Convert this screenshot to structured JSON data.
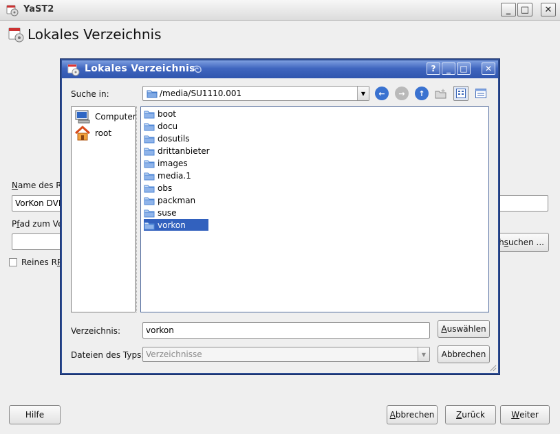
{
  "main_window": {
    "title": "YaST2",
    "heading": "Lokales Verzeichnis",
    "controls": {
      "minimize": "_",
      "maximize": "□",
      "close": "✕"
    },
    "name_label": "Name des Re",
    "name_label_mnemonic": "N",
    "name_label_rest": "ame des Re",
    "name_value": "VorKon DVD",
    "path_label_pre": "P",
    "path_label_mnemonic": "f",
    "path_label_rest": "ad zum Ver",
    "path_value": "",
    "browse_pre": "rch",
    "browse_mnemonic": "s",
    "browse_rest": "uchen ...",
    "checkbox_label_pre": "Reines R",
    "checkbox_label_mnemonic": "P",
    "help_button": "Hilfe",
    "abort_mnemonic": "A",
    "abort_rest": "bbrechen",
    "back_mnemonic": "Z",
    "back_rest": "urück",
    "next_mnemonic": "W",
    "next_rest": "eiter"
  },
  "dialog": {
    "title": "Lokales Verzeichnis",
    "controls": {
      "help": "?",
      "minimize": "_",
      "maximize": "□",
      "close": "✕"
    },
    "look_in_label": "Suche in:",
    "look_in_value": "/media/SU1110.001",
    "places": [
      {
        "label": "Computer",
        "icon": "computer-icon"
      },
      {
        "label": "root",
        "icon": "home-icon"
      }
    ],
    "files": [
      "boot",
      "docu",
      "dosutils",
      "drittanbieter",
      "images",
      "media.1",
      "obs",
      "packman",
      "suse",
      "vorkon"
    ],
    "selected_file": "vorkon",
    "dir_label": "Verzeichnis:",
    "dir_value": "vorkon",
    "type_label": "Dateien des Typs:",
    "type_value": "Verzeichnisse",
    "select_mnemonic": "A",
    "select_rest": "uswählen",
    "cancel_button": "Abbrechen"
  },
  "colors": {
    "dialog_title": "#3a60b8",
    "selection": "#3261be",
    "folder": "#4d86d6"
  }
}
